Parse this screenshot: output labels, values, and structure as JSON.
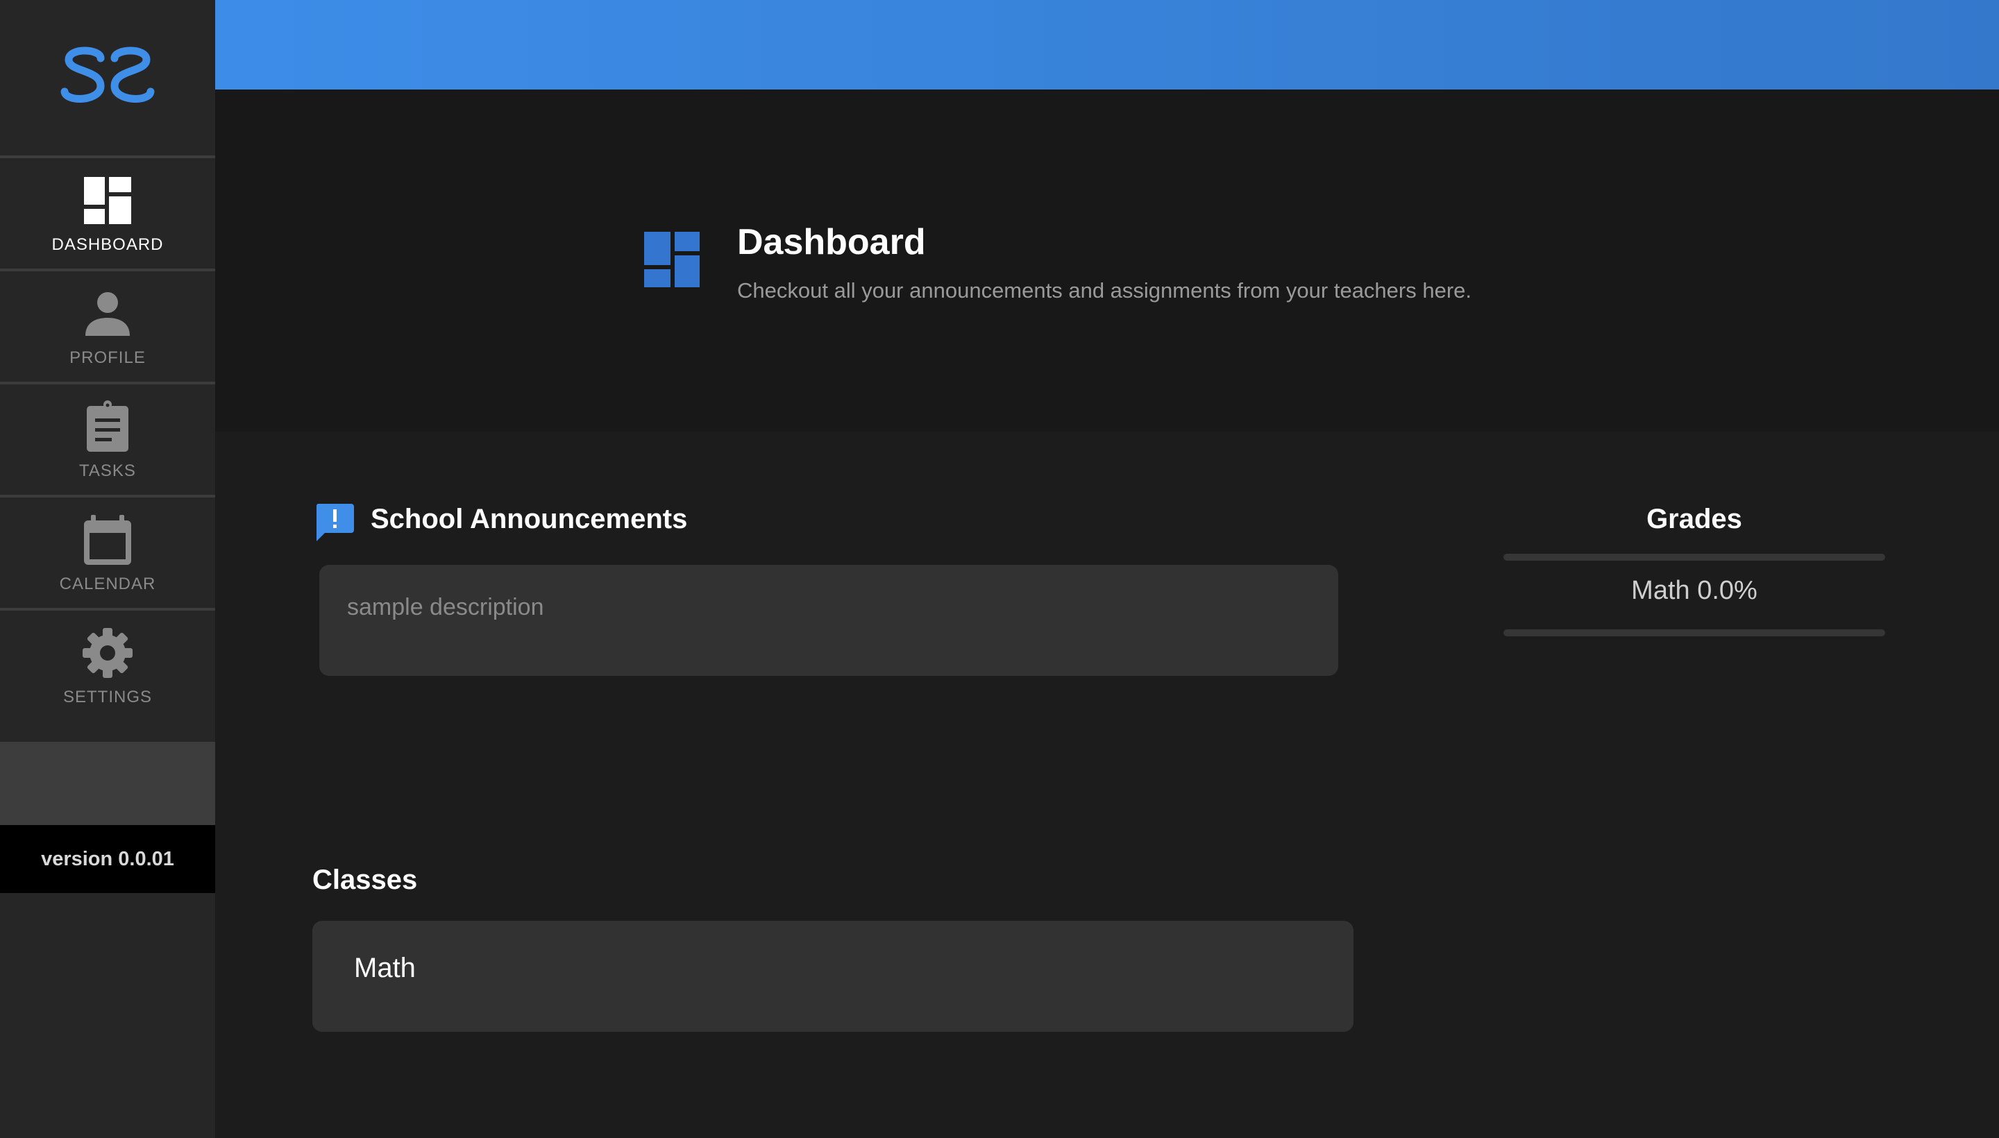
{
  "sidebar": {
    "logo": {
      "icon": "ss-logo-icon",
      "color": "#3f8ee8"
    },
    "items": [
      {
        "label": "DASHBOARD",
        "icon": "dashboard-icon",
        "active": true
      },
      {
        "label": "PROFILE",
        "icon": "person-icon",
        "active": false
      },
      {
        "label": "TASKS",
        "icon": "clipboard-icon",
        "active": false
      },
      {
        "label": "CALENDAR",
        "icon": "calendar-icon",
        "active": false
      },
      {
        "label": "SETTINGS",
        "icon": "gear-icon",
        "active": false
      }
    ],
    "version": "version 0.0.01"
  },
  "colors": {
    "accent": "#3f8ee8",
    "accent_dark": "#3378cb",
    "background": "#1c1c1c",
    "sidebar": "#262626",
    "card": "#323232"
  },
  "header": {
    "icon": "dashboard-icon",
    "title": "Dashboard",
    "subtitle": "Checkout all your announcements and assignments from your teachers here."
  },
  "announcements": {
    "icon": "announcement-icon",
    "title": "School Announcements",
    "items": [
      {
        "description": "sample description"
      }
    ]
  },
  "grades": {
    "title": "Grades",
    "items": [
      {
        "text": "Math 0.0%"
      }
    ]
  },
  "classes": {
    "title": "Classes",
    "items": [
      {
        "name": "Math"
      }
    ]
  }
}
